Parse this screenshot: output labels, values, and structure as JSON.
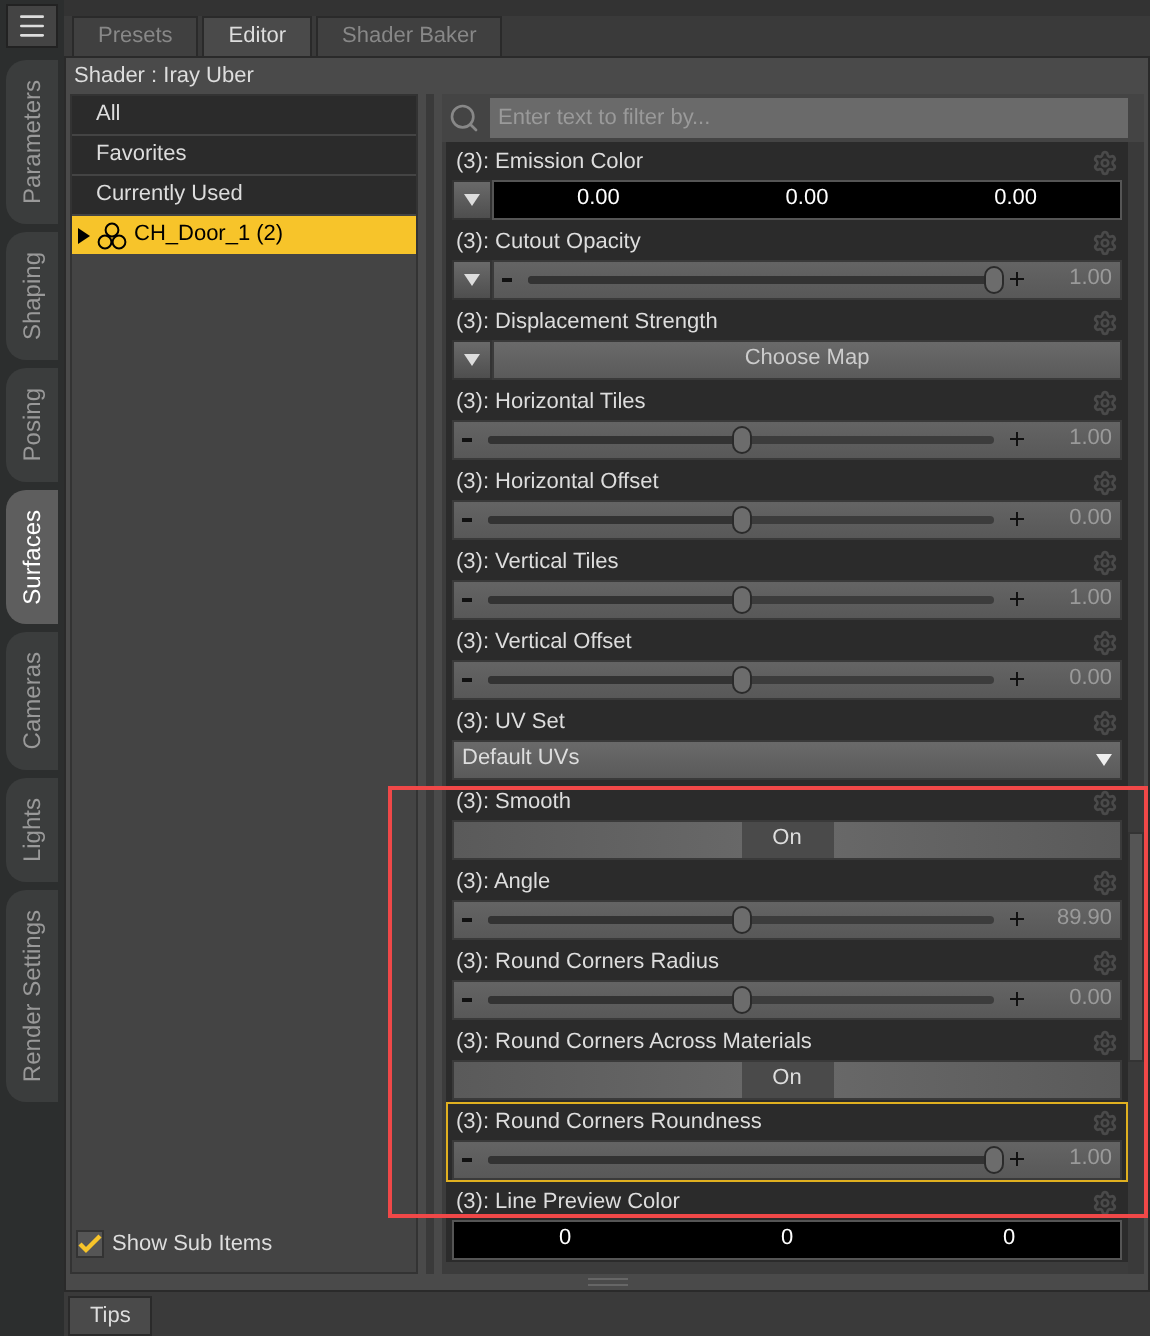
{
  "side_tabs": [
    {
      "label": "Parameters",
      "selected": false
    },
    {
      "label": "Shaping",
      "selected": false
    },
    {
      "label": "Posing",
      "selected": false
    },
    {
      "label": "Surfaces",
      "selected": true
    },
    {
      "label": "Cameras",
      "selected": false
    },
    {
      "label": "Lights",
      "selected": false
    },
    {
      "label": "Render Settings",
      "selected": false
    }
  ],
  "tabs": [
    {
      "label": "Presets",
      "selected": false
    },
    {
      "label": "Editor",
      "selected": true
    },
    {
      "label": "Shader Baker",
      "selected": false
    }
  ],
  "shader_label": "Shader : Iray Uber",
  "list": {
    "items": [
      {
        "label": "All",
        "selected": false,
        "kind": "filter"
      },
      {
        "label": "Favorites",
        "selected": false,
        "kind": "filter"
      },
      {
        "label": "Currently Used",
        "selected": false,
        "kind": "filter"
      },
      {
        "label": "CH_Door_1 (2)",
        "selected": true,
        "kind": "node"
      }
    ],
    "show_sub_items": {
      "label": "Show Sub Items",
      "checked": true
    }
  },
  "search": {
    "placeholder": "Enter text to filter by..."
  },
  "properties": [
    {
      "label": "(3): Emission Color",
      "kind": "color",
      "menu_button": true,
      "selected": false,
      "values": [
        "0.00",
        "0.00",
        "0.00"
      ]
    },
    {
      "label": "(3): Cutout Opacity",
      "kind": "slider",
      "menu_button": true,
      "selected": false,
      "level": 1,
      "reading": "1.00"
    },
    {
      "label": "(3): Displacement Strength",
      "kind": "map",
      "menu_button": true,
      "selected": false,
      "text": "Choose Map"
    },
    {
      "label": "(3): Horizontal Tiles",
      "kind": "slider",
      "menu_button": false,
      "selected": false,
      "level": 0.5,
      "reading": "1.00"
    },
    {
      "label": "(3): Horizontal Offset",
      "kind": "slider",
      "menu_button": false,
      "selected": false,
      "level": 0.5,
      "reading": "0.00"
    },
    {
      "label": "(3): Vertical Tiles",
      "kind": "slider",
      "menu_button": false,
      "selected": false,
      "level": 0.5,
      "reading": "1.00"
    },
    {
      "label": "(3): Vertical Offset",
      "kind": "slider",
      "menu_button": false,
      "selected": false,
      "level": 0.5,
      "reading": "0.00"
    },
    {
      "label": "(3): UV Set",
      "kind": "dropdown",
      "menu_button": false,
      "selected": false,
      "text": "Default UVs"
    },
    {
      "label": "(3): Smooth",
      "kind": "toggle",
      "menu_button": false,
      "selected": false,
      "on": true,
      "text": "On"
    },
    {
      "label": "(3): Angle",
      "kind": "slider",
      "menu_button": false,
      "selected": false,
      "level": 0.5,
      "reading": "89.90"
    },
    {
      "label": "(3): Round Corners Radius",
      "kind": "slider",
      "menu_button": false,
      "selected": false,
      "level": 0.5,
      "reading": "0.00"
    },
    {
      "label": "(3): Round Corners Across Materials",
      "kind": "toggle",
      "menu_button": false,
      "selected": false,
      "on": true,
      "text": "On"
    },
    {
      "label": "(3): Round Corners Roundness",
      "kind": "slider",
      "menu_button": false,
      "selected": true,
      "level": 1,
      "reading": "1.00"
    },
    {
      "label": "(3): Line Preview Color",
      "kind": "color",
      "menu_button": false,
      "selected": false,
      "values": [
        "0",
        "0",
        "0"
      ]
    }
  ],
  "bottom_tabs": [
    {
      "label": "Tips",
      "selected": true
    }
  ]
}
